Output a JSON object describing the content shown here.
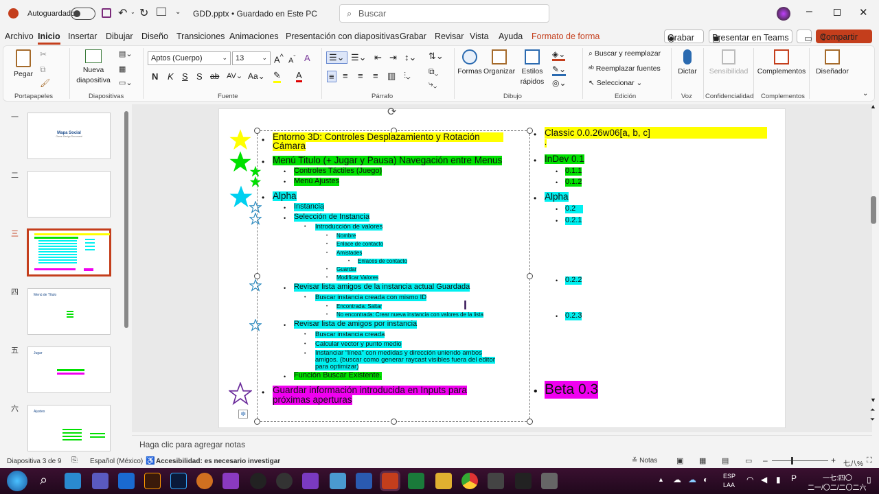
{
  "titlebar": {
    "autosave": "Autoguardado",
    "doc_title": "GDD.pptx • Guardado en Este PC",
    "search_placeholder": "Buscar"
  },
  "menu": {
    "items": [
      "Archivo",
      "Inicio",
      "Insertar",
      "Dibujar",
      "Diseño",
      "Transiciones",
      "Animaciones",
      "Presentación con diapositivas",
      "Grabar",
      "Revisar",
      "Vista",
      "Ayuda",
      "Formato de forma"
    ],
    "grabar": "Grabar",
    "teams": "Presentar en Teams",
    "share": "Compartir"
  },
  "ribbon": {
    "paste": "Pegar",
    "new_slide": "Nueva diapositiva",
    "font_name": "Aptos (Cuerpo)",
    "font_size": "13",
    "shapes": "Formas",
    "arrange": "Organizar",
    "quick_styles": "Estilos rápidos",
    "find": "Buscar y reemplazar",
    "replace": "Reemplazar fuentes",
    "select": "Seleccionar",
    "dictate": "Dictar",
    "sensitivity": "Sensibilidad",
    "addins": "Complementos",
    "designer": "Diseñador",
    "groups": {
      "clipboard": "Portapapeles",
      "slides": "Diapositivas",
      "font": "Fuente",
      "paragraph": "Párrafo",
      "drawing": "Dibujo",
      "editing": "Edición",
      "voice": "Voz",
      "confidentiality": "Confidencialidad",
      "addins": "Complementos"
    }
  },
  "thumbs": [
    {
      "num": "一",
      "title": "Mapa Social",
      "sub": "Game Design Document"
    },
    {
      "num": "二",
      "title": "",
      "sub": ""
    },
    {
      "num": "三",
      "title": "",
      "sub": ""
    },
    {
      "num": "四",
      "title": "Menú de Título",
      "sub": ""
    },
    {
      "num": "五",
      "title": "Jugar",
      "sub": ""
    },
    {
      "num": "六",
      "title": "Ajustes",
      "sub": ""
    }
  ],
  "slide": {
    "left": {
      "l1": "Entorno 3D: Controles Desplazamiento y Rotación",
      "l1b": "Cámara",
      "l2": "Menú Titulo (+ Jugar y Pausa) Navegación entre Menus",
      "l2a": "Controles Táctiles (Juego)",
      "l2b": "Menú Ajustes",
      "l3": "Alpha",
      "l3a": "Instancia",
      "l3b": "Selección de Instancia",
      "l3c": "Introducción de valores",
      "l3d": "Nombre",
      "l3e": "Enlace de contacto",
      "l3f": "Amistades",
      "l3g": "Enlaces de contacto",
      "l3h": "Guardar",
      "l3i": "Modificar Valores",
      "l4": "Revisar lista amigos de la instancia actual Guardada",
      "l4a": "Buscar instancia creada con mismo ID",
      "l4b": "Encontrada: Saltar",
      "l4c": "No encontrada: Crear nueva instancia con valores de la lista",
      "l5": "Revisar lista de amigos por instancia",
      "l5a": "Buscar instancia creada",
      "l5b": "Calcular vector y punto medio",
      "l5c": "Instanciar “línea” con medidas y dirección uniendo ambos",
      "l5d": "amigos. (buscar como generar raycast visibles fuera del editor",
      "l5e": "para optimizar)",
      "l6": "Función Buscar Existente.",
      "l7": "Guardar información introducida en Inputs para",
      "l7b": "próximas aperturas"
    },
    "right": {
      "r1": "Classic 0.0.26w06[a, b, c]",
      "r1b": ".",
      "r2": "InDev 0.1",
      "r2a": "0.1.1",
      "r2b": "0.1.2",
      "r3": "Alpha",
      "r3a": "0.2",
      "r3b": "0.2.1",
      "r3c": "0.2.2",
      "r3d": "0.2.3",
      "r4": "Beta 0.3"
    }
  },
  "notes": "Haga clic para agregar notas",
  "status": {
    "slide": "Diapositiva 3 de 9",
    "lang": "Español (México)",
    "access": "Accesibilidad: es necesario investigar",
    "notes": "Notas",
    "zoom": "七八%"
  },
  "taskbar": {
    "lang1": "ESP",
    "lang2": "LAA",
    "time": "一七:四〇",
    "date": "二一/〇二/二〇二六"
  },
  "colors": {
    "accent": "#c43e1c",
    "yellow": "#ffff00",
    "green": "#00e000",
    "cyan": "#00f0f0",
    "magenta": "#f000f0"
  }
}
